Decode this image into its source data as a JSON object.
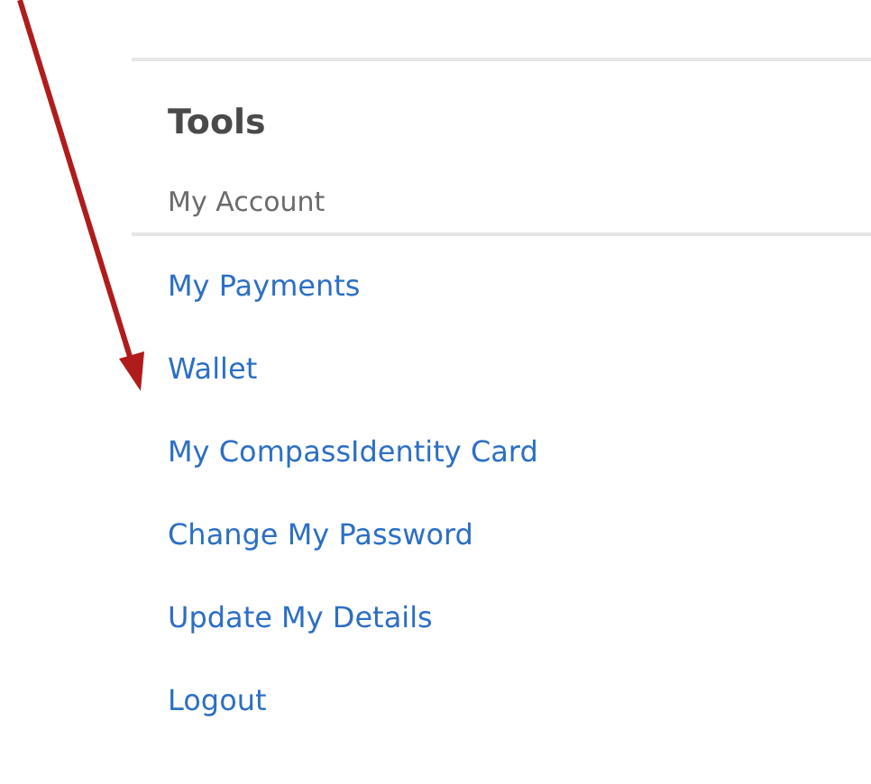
{
  "panel": {
    "title": "Tools",
    "section": "My Account",
    "links": [
      {
        "label": "My Payments"
      },
      {
        "label": "Wallet"
      },
      {
        "label": "My CompassIdentity Card"
      },
      {
        "label": "Change My Password"
      },
      {
        "label": "Update My Details"
      },
      {
        "label": "Logout"
      }
    ]
  }
}
